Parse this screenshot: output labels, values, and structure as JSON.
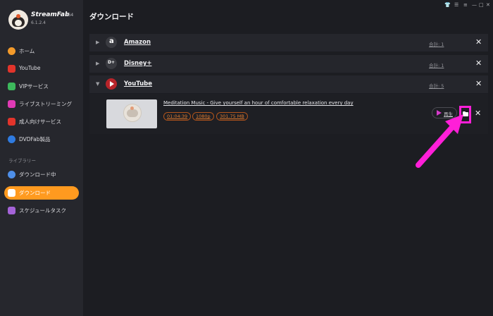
{
  "app": {
    "brand_name": "StreamFab",
    "arch": "x64",
    "version": "6.1.2.4"
  },
  "window_icons": [
    "shirt-icon",
    "list-icon",
    "menu-icon",
    "minimize-icon",
    "maximize-icon",
    "close-icon"
  ],
  "sidebar": {
    "items": [
      {
        "label": "ホーム",
        "icon": "home-icon",
        "color": "#f39a2a"
      },
      {
        "label": "YouTube",
        "icon": "youtube-icon",
        "color": "#e2342b"
      },
      {
        "label": "VIPサービス",
        "icon": "key-icon",
        "color": "#3db95c"
      },
      {
        "label": "ライブストリーミング",
        "icon": "camera-icon",
        "color": "#e03ab5"
      },
      {
        "label": "成人向けサービス",
        "icon": "adult-icon",
        "color": "#e2342b"
      },
      {
        "label": "DVDFab製品",
        "icon": "dvdfab-icon",
        "color": "#2f7be0"
      }
    ],
    "library_label": "ライブラリー",
    "library_items": [
      {
        "label": "ダウンロード中",
        "icon": "download-arrow-icon",
        "color": "#4e8fe8",
        "active": false
      },
      {
        "label": "ダウンロード",
        "icon": "download-folder-icon",
        "color": "#f39a2a",
        "active": true
      },
      {
        "label": "スケジュールタスク",
        "icon": "calendar-icon",
        "color": "#a463d8",
        "active": false
      }
    ]
  },
  "main": {
    "title": "ダウンロード",
    "groups": [
      {
        "name": "Amazon",
        "total": "合計: 1",
        "icon": "amazon-icon",
        "expanded": false
      },
      {
        "name": "Disney+",
        "total": "合計: 1",
        "icon": "disney-icon",
        "expanded": false
      },
      {
        "name": "YouTube",
        "total": "合計: 5",
        "icon": "youtube-icon",
        "expanded": true
      }
    ],
    "item": {
      "title": "Meditation Music - Give yourself an hour of comfortable relaxation every day",
      "duration": "01:04:39",
      "resolution": "1080p",
      "size": "301.75 MB",
      "play_label": "再生"
    }
  },
  "colors": {
    "accent": "#ff9a1f",
    "highlight": "#ff1fd8",
    "chip": "#e07b2e"
  }
}
